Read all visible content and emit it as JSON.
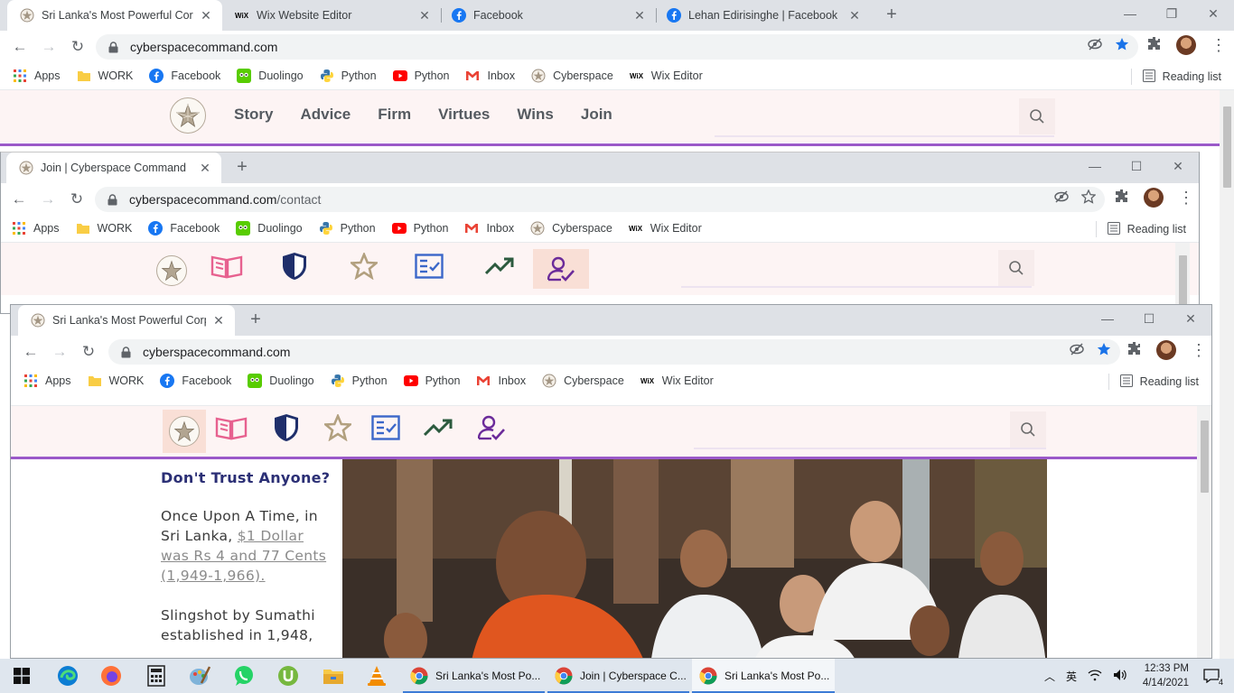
{
  "windows": {
    "w1": {
      "tabs": [
        {
          "title": "Sri Lanka's Most Powerful Corpor",
          "icon": "cyberspace-star-icon"
        },
        {
          "title": "Wix Website Editor",
          "icon": "wix-icon"
        },
        {
          "title": "Facebook",
          "icon": "facebook-icon"
        },
        {
          "title": "Lehan Edirisinghe | Facebook",
          "icon": "facebook-icon"
        }
      ],
      "url": "cyberspacecommand.com",
      "url_path": "",
      "nav_items": [
        "Story",
        "Advice",
        "Firm",
        "Virtues",
        "Wins",
        "Join"
      ]
    },
    "w2": {
      "tabs": [
        {
          "title": "Join | Cyberspace Command",
          "icon": "cyberspace-star-icon"
        }
      ],
      "url": "cyberspacecommand.com",
      "url_path": "/contact"
    },
    "w3": {
      "tabs": [
        {
          "title": "Sri Lanka's Most Powerful Corpor",
          "icon": "cyberspace-star-icon"
        }
      ],
      "url": "cyberspacecommand.com",
      "url_path": ""
    }
  },
  "bookmarks": [
    "Apps",
    "WORK",
    "Facebook",
    "Duolingo",
    "Python",
    "Python",
    "Inbox",
    "Cyberspace",
    "Wix Editor"
  ],
  "reading_list": "Reading list",
  "article": {
    "heading": "Don't Trust Anyone?",
    "p1_lead": "Once Upon A Time, in Sri Lanka, ",
    "p1_link": "$1 Dollar was Rs 4 and 77 Cents (1,949-1,966).",
    "p2": "Slingshot by Sumathi established in 1,948,"
  },
  "taskbar": {
    "apps": [
      "Sri Lanka's Most Po...",
      "Join | Cyberspace C...",
      "Sri Lanka's Most Po..."
    ],
    "time": "12:33 PM",
    "date": "4/14/2021",
    "notifications": "4",
    "ime": "英"
  },
  "colors": {
    "accent_rule": "#9b59c9",
    "header_bg": "#fdf4f4",
    "heading": "#2b2f75"
  }
}
